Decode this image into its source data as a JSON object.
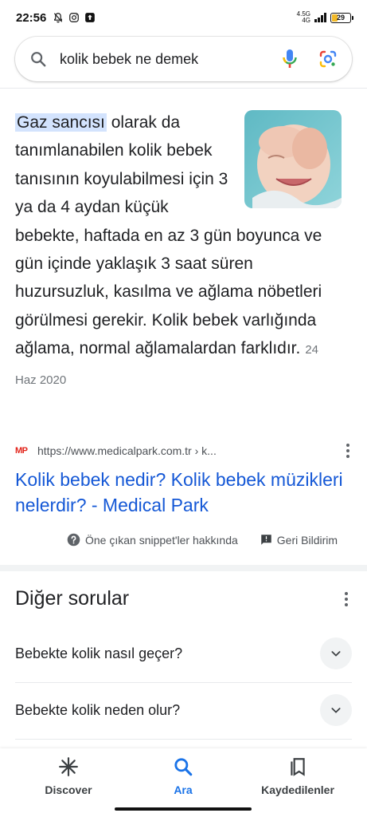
{
  "status_bar": {
    "time": "22:56",
    "network": "4.5G",
    "network_sub": "4G",
    "battery": "29",
    "icons": [
      "bell-off-icon",
      "instagram-icon",
      "upload-app-icon",
      "signal-icon",
      "battery-icon"
    ]
  },
  "search": {
    "query": "kolik bebek ne demek",
    "icons": [
      "search-icon",
      "mic-icon",
      "lens-icon"
    ]
  },
  "snippet": {
    "highlight": "Gaz sancısı",
    "text": " olarak da tanımlanabilen kolik bebek tanısının koyulabilmesi için 3 ya da 4 aydan küçük bebekte, haftada en az 3 gün boyunca ve gün içinde yaklaşık 3 saat süren huzursuzluk, kasılma ve ağlama nöbetleri görülmesi gerekir. Kolik bebek varlığında ağlama, normal ağlamalardan farklıdır.",
    "date": "24 Haz 2020",
    "source_logo": "MP",
    "source_url": "https://www.medicalpark.com.tr › k...",
    "title": "Kolik bebek nedir? Kolik bebek müzikleri nelerdir? - Medical Park",
    "about_label": "Öne çıkan snippet'ler hakkında",
    "feedback_label": "Geri Bildirim"
  },
  "other_questions": {
    "title": "Diğer sorular",
    "items": [
      {
        "label": "Bebekte kolik nasıl geçer?"
      },
      {
        "label": "Bebekte kolik neden olur?"
      }
    ]
  },
  "bottom_nav": {
    "items": [
      {
        "label": "Discover",
        "icon": "asterisk-icon"
      },
      {
        "label": "Ara",
        "icon": "search-icon",
        "active": true
      },
      {
        "label": "Kaydedilenler",
        "icon": "bookmarks-icon"
      }
    ]
  },
  "colors": {
    "link": "#1558d6",
    "highlight": "#d3e3fd",
    "active_nav": "#1a73e8",
    "logo_red": "#e2231a"
  }
}
